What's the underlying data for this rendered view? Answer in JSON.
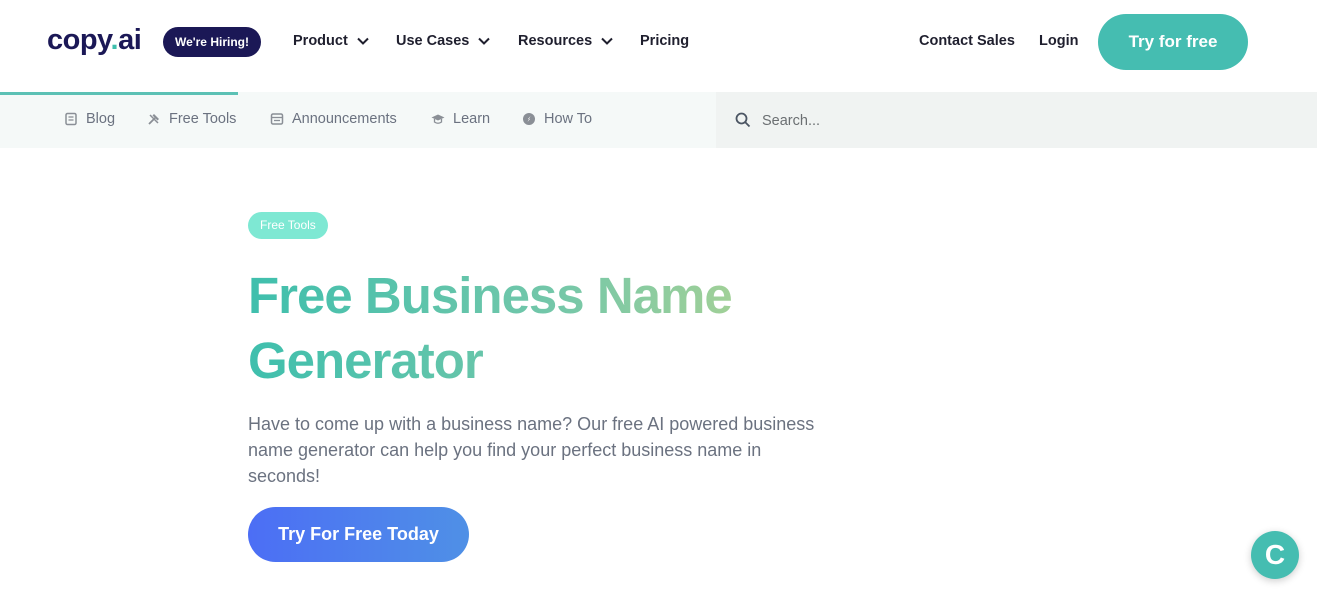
{
  "brand": {
    "logo_main": "copy",
    "logo_dot": ".",
    "logo_tld": "ai",
    "hiring_badge": "We're Hiring!"
  },
  "nav": {
    "items": [
      {
        "label": "Product",
        "has_dropdown": true
      },
      {
        "label": "Use Cases",
        "has_dropdown": true
      },
      {
        "label": "Resources",
        "has_dropdown": true
      },
      {
        "label": "Pricing",
        "has_dropdown": false
      }
    ],
    "contact_sales": "Contact Sales",
    "login": "Login",
    "try_free": "Try for free"
  },
  "subnav": {
    "items": [
      {
        "label": "Blog",
        "icon": "document-icon"
      },
      {
        "label": "Free Tools",
        "icon": "tools-icon"
      },
      {
        "label": "Announcements",
        "icon": "announcement-icon"
      },
      {
        "label": "Learn",
        "icon": "graduation-cap-icon"
      },
      {
        "label": "How To",
        "icon": "compass-icon"
      }
    ],
    "active": "Free Tools",
    "search_placeholder": "Search..."
  },
  "hero": {
    "tag": "Free Tools",
    "title": "Free Business Name Generator",
    "description": "Have to come up with a business name? Our free AI powered business name generator can help you find your perfect business name in seconds!",
    "cta": "Try For Free Today"
  },
  "chat_widget": {
    "letter": "C"
  },
  "colors": {
    "brand_navy": "#1b1856",
    "accent_teal": "#45bdb1",
    "cta_blue": "#4c6ef5"
  }
}
